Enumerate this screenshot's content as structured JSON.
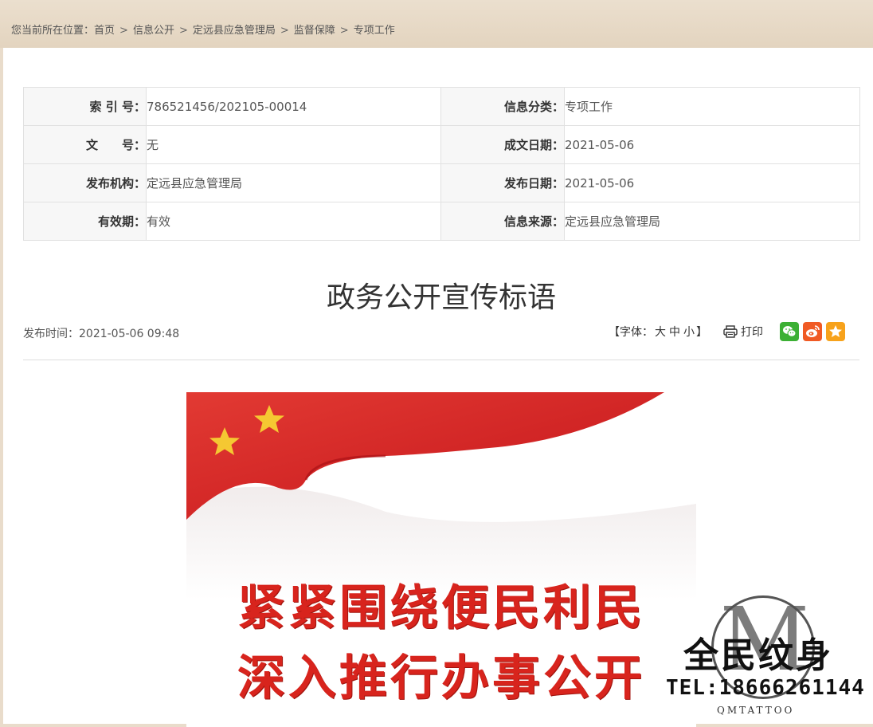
{
  "breadcrumb": {
    "prefix": "您当前所在位置：",
    "items": [
      "首页",
      "信息公开",
      "定远县应急管理局",
      "监督保障",
      "专项工作"
    ],
    "separator": ">"
  },
  "meta_table": {
    "rows": [
      [
        {
          "label": "索 引 号：",
          "value": "786521456/202105-00014"
        },
        {
          "label": "信息分类：",
          "value": "专项工作"
        }
      ],
      [
        {
          "label": "文　　号：",
          "value": "无"
        },
        {
          "label": "成文日期：",
          "value": "2021-05-06"
        }
      ],
      [
        {
          "label": "发布机构：",
          "value": "定远县应急管理局"
        },
        {
          "label": "发布日期：",
          "value": "2021-05-06"
        }
      ],
      [
        {
          "label": "有效期：",
          "value": "有效"
        },
        {
          "label": "信息来源：",
          "value": "定远县应急管理局"
        }
      ]
    ]
  },
  "article": {
    "title": "政务公开宣传标语",
    "publish_time": "发布时间：2021-05-06 09:48"
  },
  "tools": {
    "font_prefix": "【字体：",
    "font_large": "大",
    "font_medium": "中",
    "font_small": "小",
    "font_suffix": "】",
    "print_label": "打印"
  },
  "share": {
    "wechat_color": "#3cb034",
    "weibo_color": "#f05a24",
    "favorite_color": "#f7a21b"
  },
  "poster": {
    "line1": "紧紧围绕便民利民",
    "line2": "深入推行办事公开"
  },
  "watermark": {
    "letter": "M",
    "name": "全民纹身",
    "tel": "TEL:18666261144",
    "sub": "QMTATTOO"
  },
  "colors": {
    "accent_red": "#d8241d",
    "page_bg": "#e9dccb"
  }
}
